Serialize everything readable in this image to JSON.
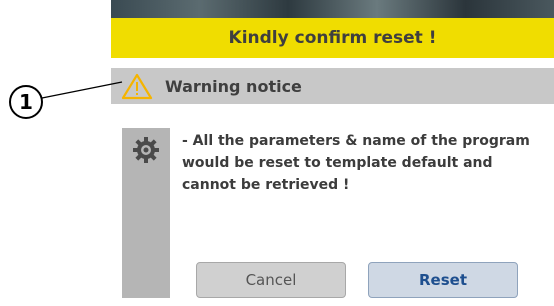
{
  "dialog": {
    "title": "Kindly confirm reset !",
    "notice": {
      "icon": "warning-triangle-icon",
      "label": "Warning notice"
    },
    "message_icon": "gear-icon",
    "message_lines": [
      "- All the parameters & name of the program",
      "would be reset to template default and",
      "cannot be retrieved !"
    ],
    "buttons": {
      "cancel_label": "Cancel",
      "reset_label": "Reset"
    }
  },
  "callout": {
    "label": "1"
  },
  "colors": {
    "title_bar": "#f0dd00",
    "notice_bar": "#c8c8c8",
    "warning_icon": "#f5b400",
    "reset_text": "#1e4f8f"
  }
}
